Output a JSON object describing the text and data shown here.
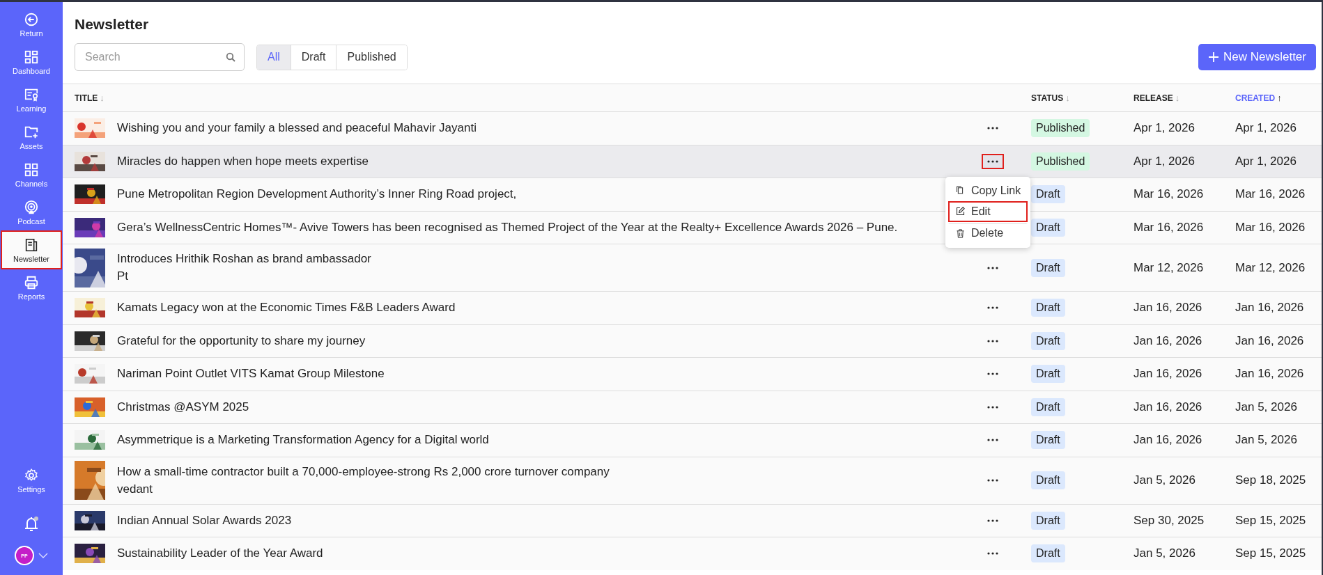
{
  "sidebar": {
    "items": [
      {
        "label": "Return",
        "selected": false,
        "highlighted": false
      },
      {
        "label": "Dashboard",
        "selected": false,
        "highlighted": false
      },
      {
        "label": "Learning",
        "selected": false,
        "highlighted": false
      },
      {
        "label": "Assets",
        "selected": false,
        "highlighted": false
      },
      {
        "label": "Channels",
        "selected": false,
        "highlighted": false
      },
      {
        "label": "Podcast",
        "selected": false,
        "highlighted": false
      },
      {
        "label": "Newsletter",
        "selected": true,
        "highlighted": true
      },
      {
        "label": "Reports",
        "selected": false,
        "highlighted": false
      }
    ],
    "settings": {
      "label": "Settings"
    },
    "notifications": {
      "unread": true
    },
    "user": {
      "initials": "PP"
    }
  },
  "page": {
    "title": "Newsletter"
  },
  "search": {
    "placeholder": "Search"
  },
  "filters": [
    {
      "label": "All",
      "selected": true
    },
    {
      "label": "Draft",
      "selected": false
    },
    {
      "label": "Published",
      "selected": false
    }
  ],
  "new_button": {
    "label": "New Newsletter"
  },
  "table": {
    "columns": [
      {
        "label": "TITLE",
        "sorted": false,
        "arrow": "↓"
      },
      {
        "label": "STATUS",
        "sorted": false,
        "arrow": "↓"
      },
      {
        "label": "RELEASE",
        "sorted": false,
        "arrow": "↓"
      },
      {
        "label": "CREATED",
        "sorted": true,
        "arrow": "↑"
      }
    ],
    "rows": [
      {
        "title": "Wishing you and your family a blessed and peaceful Mahavir Jayanti",
        "status": {
          "label": "Published",
          "kind": "published"
        },
        "release": "Apr 1, 2026",
        "created": "Apr 1, 2026",
        "selected": false,
        "actions_highlighted": false
      },
      {
        "title": "Miracles do happen when hope meets expertise",
        "status": {
          "label": "Published",
          "kind": "published"
        },
        "release": "Apr 1, 2026",
        "created": "Apr 1, 2026",
        "selected": true,
        "actions_highlighted": true,
        "menu": [
          {
            "label": "Copy Link",
            "highlighted": false
          },
          {
            "label": "Edit",
            "highlighted": true
          },
          {
            "label": "Delete",
            "highlighted": false
          }
        ]
      },
      {
        "title": "Pune Metropolitan Region Development Authority’s Inner Ring Road project,",
        "status": {
          "label": "Draft",
          "kind": "draft"
        },
        "release": "Mar 16, 2026",
        "created": "Mar 16, 2026",
        "selected": false
      },
      {
        "title": "Gera’s WellnessCentric Homes™- Avive Towers has been recognised as Themed Project of the Year at the Realty+ Excellence Awards 2026 – Pune.",
        "status": {
          "label": "Draft",
          "kind": "draft"
        },
        "release": "Mar 16, 2026",
        "created": "Mar 16, 2026",
        "selected": false
      },
      {
        "title": "Introduces Hrithik Roshan as brand ambassador",
        "subtitle": "Pt",
        "status": {
          "label": "Draft",
          "kind": "draft"
        },
        "release": "Mar 12, 2026",
        "created": "Mar 12, 2026",
        "selected": false,
        "actions_highlighted": false
      },
      {
        "title": "Kamats Legacy won at the Economic Times F&B Leaders Award",
        "status": {
          "label": "Draft",
          "kind": "draft"
        },
        "release": "Jan 16, 2026",
        "created": "Jan 16, 2026",
        "selected": false,
        "actions_highlighted": false
      },
      {
        "title": "Grateful for the opportunity to share my journey",
        "status": {
          "label": "Draft",
          "kind": "draft"
        },
        "release": "Jan 16, 2026",
        "created": "Jan 16, 2026",
        "selected": false,
        "actions_highlighted": false
      },
      {
        "title": "Nariman Point Outlet VITS Kamat Group Milestone",
        "status": {
          "label": "Draft",
          "kind": "draft"
        },
        "release": "Jan 16, 2026",
        "created": "Jan 16, 2026",
        "selected": false,
        "actions_highlighted": false
      },
      {
        "title": "Christmas @ASYM 2025",
        "status": {
          "label": "Draft",
          "kind": "draft"
        },
        "release": "Jan 16, 2026",
        "created": "Jan 5, 2026",
        "selected": false,
        "actions_highlighted": false
      },
      {
        "title": "Asymmetrique is a Marketing Transformation Agency for a Digital world",
        "status": {
          "label": "Draft",
          "kind": "draft"
        },
        "release": "Jan 16, 2026",
        "created": "Jan 5, 2026",
        "selected": false,
        "actions_highlighted": false
      },
      {
        "title": "How a small-time contractor built a 70,000-employee-strong Rs 2,000 crore turnover company",
        "subtitle": "vedant",
        "status": {
          "label": "Draft",
          "kind": "draft"
        },
        "release": "Jan 5, 2026",
        "created": "Sep 18, 2025",
        "selected": false,
        "actions_highlighted": false
      },
      {
        "title": "Indian Annual Solar Awards 2023",
        "status": {
          "label": "Draft",
          "kind": "draft"
        },
        "release": "Sep 30, 2025",
        "created": "Sep 15, 2025",
        "selected": false,
        "actions_highlighted": false
      },
      {
        "title": "Sustainability Leader of the Year Award",
        "status": {
          "label": "Draft",
          "kind": "draft"
        },
        "release": "Jan 5, 2026",
        "created": "Sep 15, 2025",
        "selected": false,
        "actions_highlighted": false
      }
    ]
  }
}
